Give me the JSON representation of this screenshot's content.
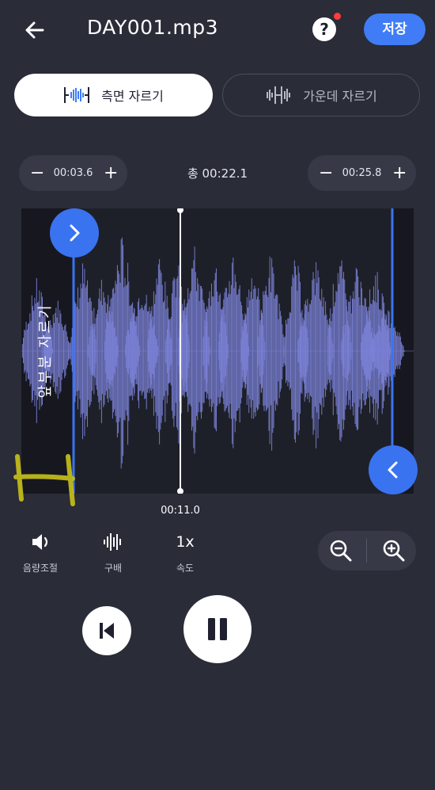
{
  "header": {
    "title": "DAY001.mp3",
    "help_symbol": "?",
    "save_label": "저장"
  },
  "tabs": [
    {
      "label": "측면 자르기",
      "selected": true
    },
    {
      "label": "가운데 자르기",
      "selected": false
    }
  ],
  "trim": {
    "start_time": "00:03.6",
    "end_time": "00:25.8",
    "total_label": "총 00:22.1",
    "decrease_symbol": "−",
    "increase_symbol": "+"
  },
  "waveform": {
    "trimmed_section_label": "앞부분 자르기",
    "playhead_time": "00:11.0",
    "colors": {
      "wave": "#7c82d8",
      "handle": "#3a73f0",
      "playhead": "#ffffff",
      "annotation": "#c9c21a"
    }
  },
  "controls": {
    "volume_label": "음량조절",
    "pitch_label": "구배",
    "speed_value": "1x",
    "speed_label": "속도"
  },
  "icons": {
    "back": "arrow-left-icon",
    "help": "help-icon",
    "wave_side": "waveform-side-icon",
    "wave_middle": "waveform-middle-icon",
    "start_handle": "chevron-right-icon",
    "end_handle": "chevron-left-icon",
    "volume": "speaker-icon",
    "pitch": "waveform-icon",
    "zoom_out": "zoom-out-icon",
    "zoom_in": "zoom-in-icon",
    "prev": "skip-previous-icon",
    "pause": "pause-icon"
  }
}
